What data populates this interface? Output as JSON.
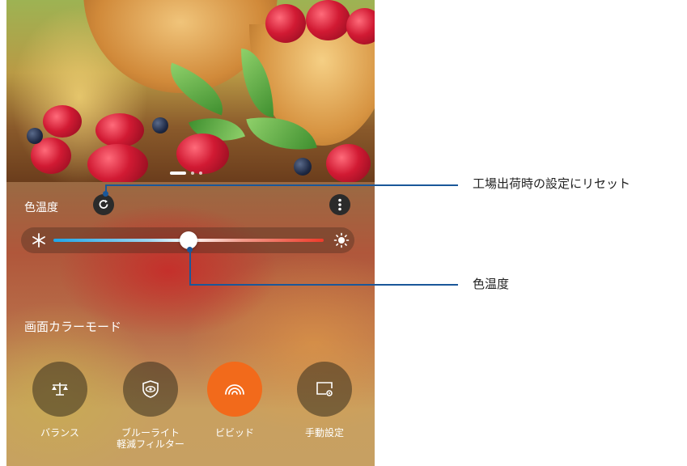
{
  "controls": {
    "color_temp_label": "色温度",
    "reset_icon": "refresh-icon",
    "more_icon": "more-vertical-icon",
    "slider": {
      "value_fraction": 0.5,
      "cold_icon": "snowflake-icon",
      "warm_icon": "sun-icon"
    }
  },
  "color_mode": {
    "title": "画面カラーモード",
    "modes": [
      {
        "label": "バランス",
        "icon": "balance-scale-icon",
        "active": false
      },
      {
        "label": "ブルーライト\n軽減フィルター",
        "icon": "eye-shield-icon",
        "active": false
      },
      {
        "label": "ビビッド",
        "icon": "rainbow-icon",
        "active": true
      },
      {
        "label": "手動設定",
        "icon": "screen-settings-icon",
        "active": false
      }
    ]
  },
  "callouts": {
    "reset": "工場出荷時の設定にリセット",
    "color_temp": "色温度"
  },
  "colors": {
    "accent": "#f26a1b",
    "callout_line": "#1a5799"
  }
}
